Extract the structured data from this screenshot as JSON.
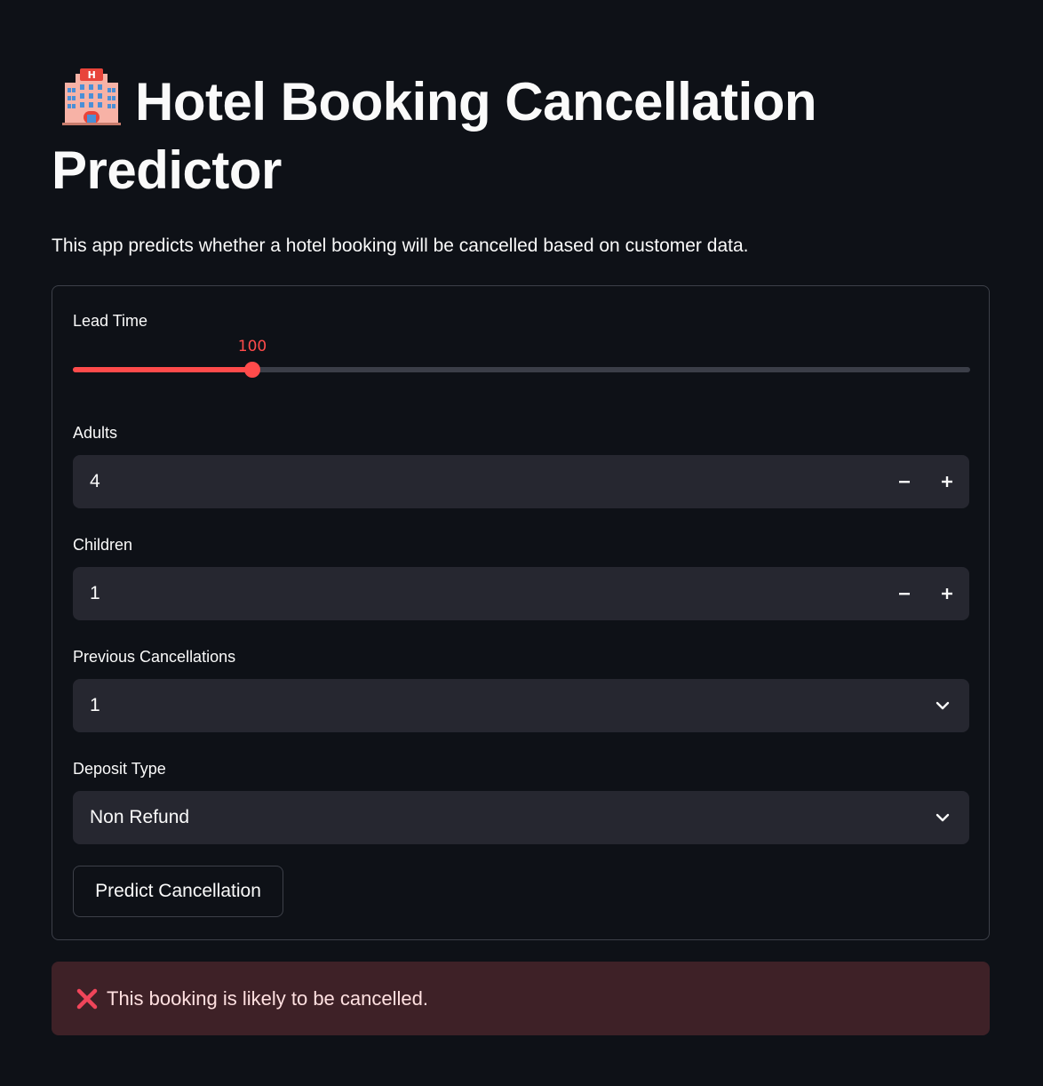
{
  "header": {
    "title_line1": "Hotel Booking Cancellation",
    "title_line2": "Predictor",
    "title_icon": "hotel-emoji",
    "subtitle": "This app predicts whether a hotel booking will be cancelled based on customer data."
  },
  "form": {
    "lead_time": {
      "label": "Lead Time",
      "value": "100",
      "min": 0,
      "max": 500
    },
    "adults": {
      "label": "Adults",
      "value": "4",
      "decrement_icon": "minus-icon",
      "increment_icon": "plus-icon"
    },
    "children": {
      "label": "Children",
      "value": "1",
      "decrement_icon": "minus-icon",
      "increment_icon": "plus-icon"
    },
    "previous_cancellations": {
      "label": "Previous Cancellations",
      "value": "1",
      "icon": "chevron-down-icon"
    },
    "deposit_type": {
      "label": "Deposit Type",
      "value": "Non Refund",
      "icon": "chevron-down-icon"
    },
    "submit_label": "Predict Cancellation"
  },
  "result": {
    "icon": "cross-mark-icon",
    "message": "This booking is likely to be cancelled."
  },
  "colors": {
    "background": "#0e1117",
    "accent": "#ff4b4b",
    "input_bg": "#262730",
    "error_bg": "#3e2127"
  }
}
